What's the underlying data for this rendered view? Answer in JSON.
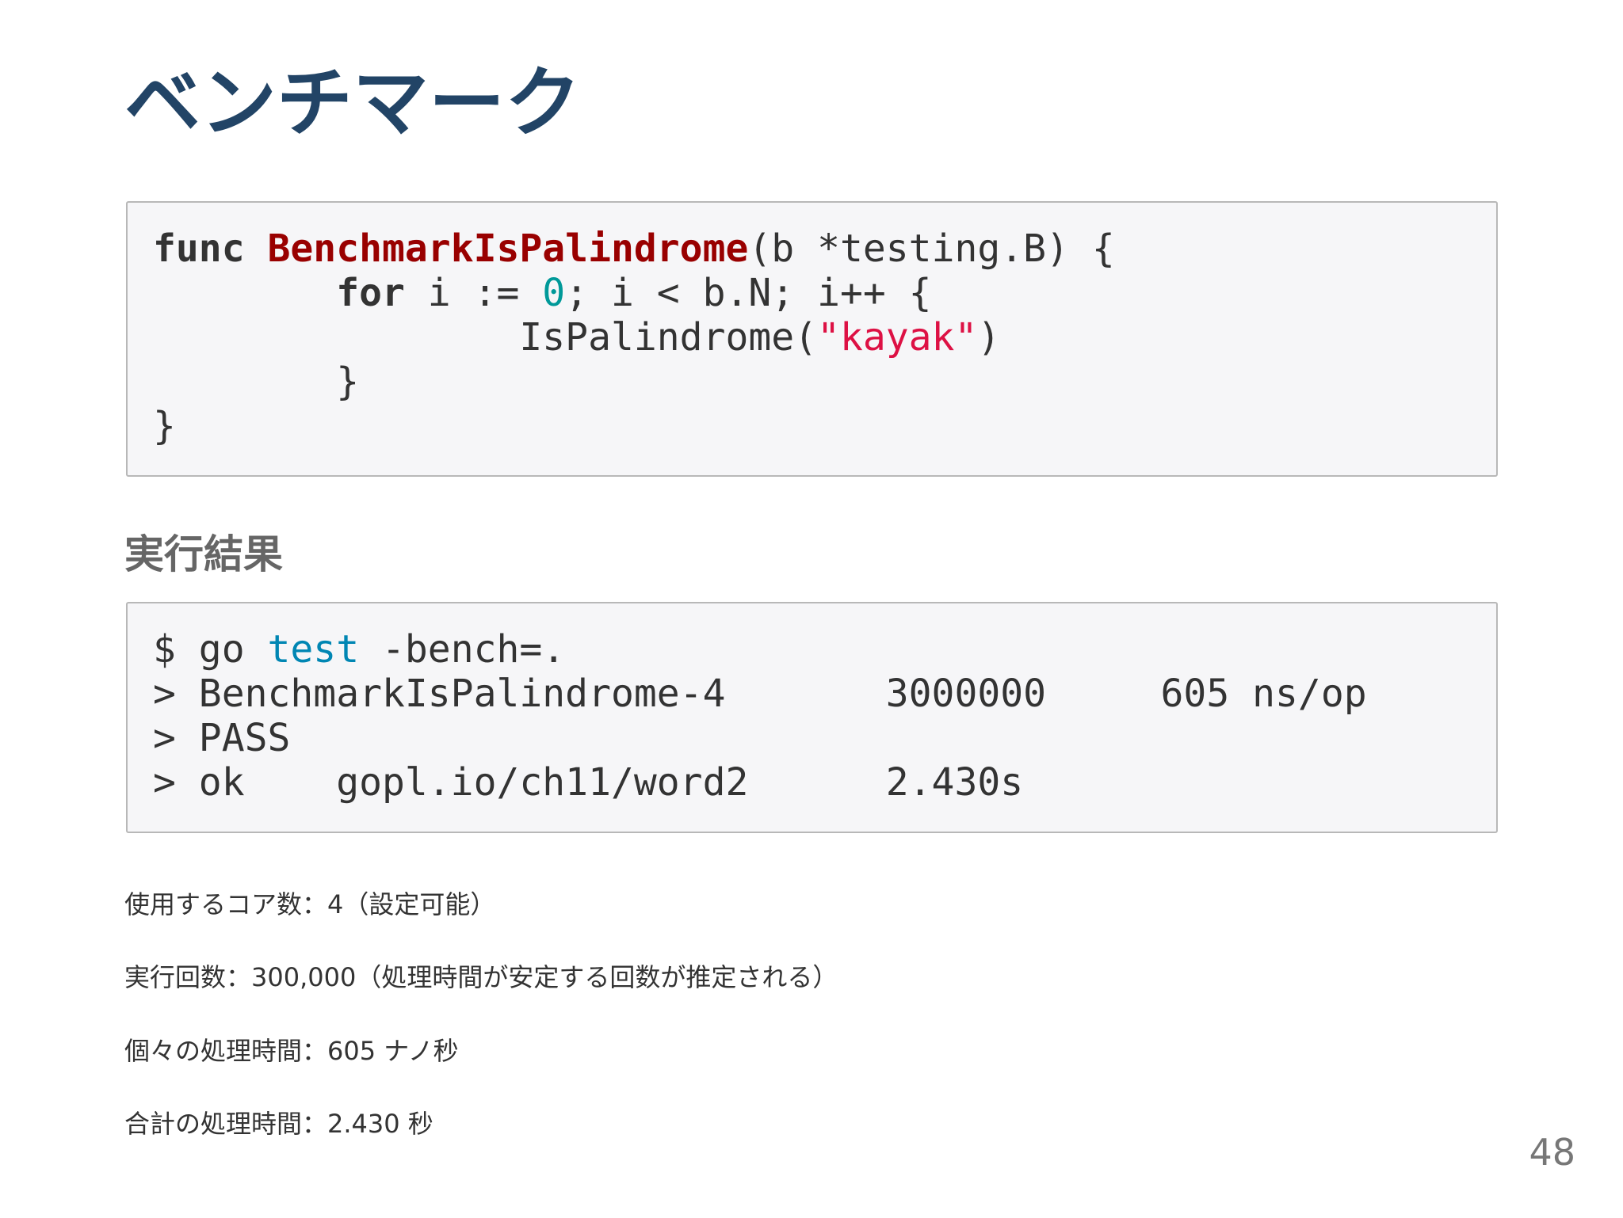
{
  "title": "ベンチマーク",
  "code_block_1": {
    "l1_keyword": "func",
    "l1_space": " ",
    "l1_function": "BenchmarkIsPalindrome",
    "l1_rest": "(b *testing.B) {",
    "l2_indent": "        ",
    "l2_keyword": "for",
    "l2_mid": " i := ",
    "l2_number": "0",
    "l2_rest": "; i < b.N; i++ {",
    "l3_code": "                IsPalindrome(",
    "l3_string": "\"kayak\"",
    "l3_rest": ")",
    "l4": "        }",
    "l5": "}"
  },
  "result_heading": "実行結果",
  "code_block_2": {
    "l1_prompt": "$ go ",
    "l1_command": "test",
    "l1_rest": " -bench=.",
    "l2": "> BenchmarkIsPalindrome-4       3000000     605 ns/op",
    "l3": "> PASS",
    "l4": "> ok    gopl.io/ch11/word2      2.430s"
  },
  "notes": [
    "使用するコア数：4（設定可能）",
    "実行回数：300,000（処理時間が安定する回数が推定される）",
    "個々の処理時間：605 ナノ秒",
    "合計の処理時間：2.430 秒"
  ],
  "page_number": "48",
  "colors": {
    "title": "#224466",
    "function_name": "#990000",
    "number_literal": "#009999",
    "string_literal": "#dd1144",
    "command": "#0086b3",
    "code_background": "#f6f6f8"
  }
}
